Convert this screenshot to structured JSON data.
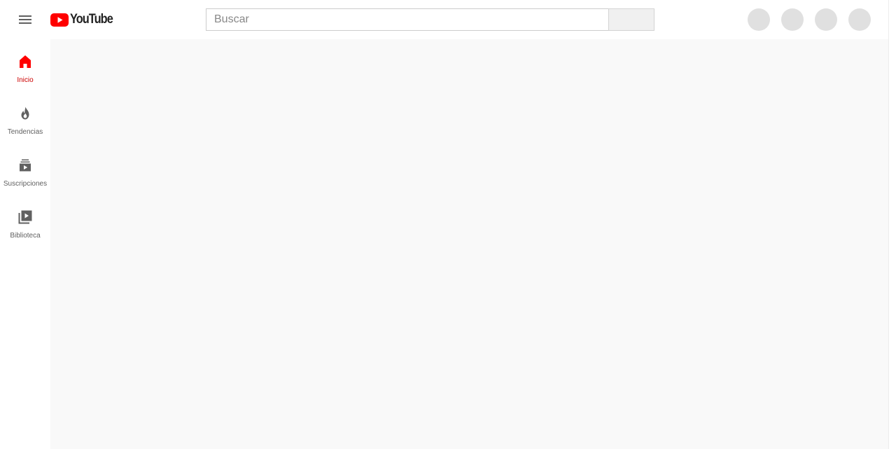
{
  "app": {
    "logo_text": "YouTube",
    "brand_color": "#ff0000"
  },
  "header": {
    "menu_icon": "hamburger-menu-icon",
    "search": {
      "placeholder": "Buscar",
      "value": ""
    }
  },
  "sidebar": {
    "items": [
      {
        "label": "Inicio",
        "icon": "home-icon",
        "active": true
      },
      {
        "label": "Tendencias",
        "icon": "trending-flame-icon",
        "active": false
      },
      {
        "label": "Suscripciones",
        "icon": "subscriptions-icon",
        "active": false
      },
      {
        "label": "Biblioteca",
        "icon": "library-icon",
        "active": false
      }
    ],
    "active_color": "#cc0000",
    "inactive_color": "#606060"
  },
  "content": {
    "background": "#f9f9f9"
  }
}
